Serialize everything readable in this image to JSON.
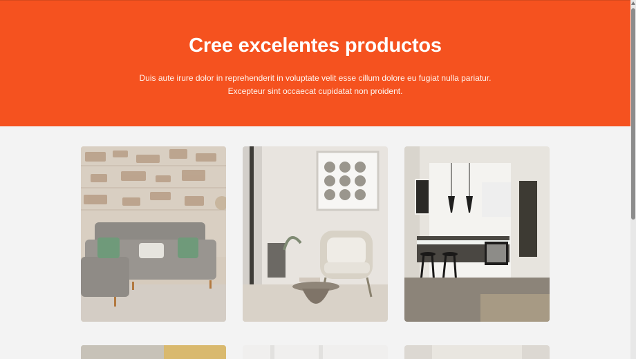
{
  "hero": {
    "title": "Cree excelentes productos",
    "text_line_1": "Duis aute irure dolor in reprehenderit in voluptate velit esse cillum dolore eu fugiat nulla pariatur.",
    "text_line_2": "Excepteur sint occaecat cupidatat non proident.",
    "background": "#f5521f"
  },
  "gallery": {
    "cards": [
      {
        "icon": "living-room-photo"
      },
      {
        "icon": "armchair-photo"
      },
      {
        "icon": "kitchen-photo"
      },
      {
        "icon": "photo-partial"
      },
      {
        "icon": "photo-partial"
      },
      {
        "icon": "photo-partial"
      }
    ]
  }
}
